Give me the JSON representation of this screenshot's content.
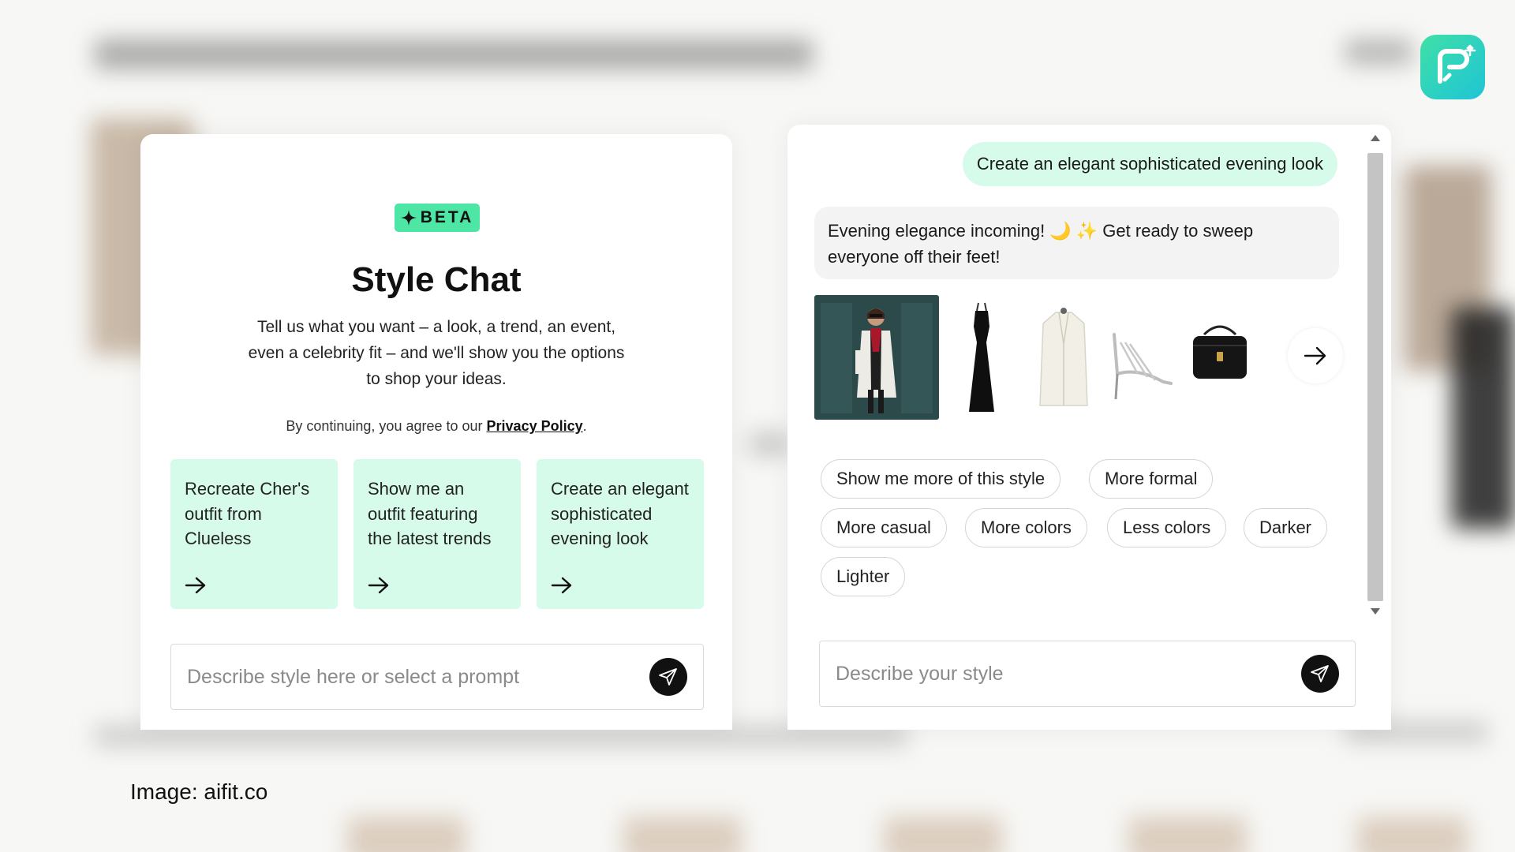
{
  "app_logo": {
    "name": "p-sparkle-logo",
    "colors": [
      "#3fe0a6",
      "#1fc4d6"
    ]
  },
  "left_panel": {
    "badge": "BETA",
    "title": "Style Chat",
    "intro": "Tell us what you want – a look, a trend, an event, even a celebrity fit – and we'll show you the options to shop your ideas.",
    "consent_prefix": "By continuing, you agree to our ",
    "privacy_link": "Privacy Policy",
    "consent_suffix": ".",
    "prompts": [
      {
        "text": "Recreate Cher's outfit from Clueless"
      },
      {
        "text": "Show me an outfit featuring the latest trends"
      },
      {
        "text": "Create an elegant sophisticated evening look"
      }
    ],
    "input_placeholder": "Describe style here or select a prompt"
  },
  "right_panel": {
    "user_message": "Create an elegant sophisticated evening look",
    "bot_message": "Evening elegance incoming! 🌙 ✨ Get ready to sweep everyone off their feet!",
    "products": [
      {
        "name": "woman-in-white-blazer-outfit"
      },
      {
        "name": "black-maxi-dress"
      },
      {
        "name": "white-blazer"
      },
      {
        "name": "silver-strappy-heels"
      },
      {
        "name": "black-shoulder-bag"
      }
    ],
    "chips": [
      "Show me more of this style",
      "More formal",
      "More casual",
      "More colors",
      "Less colors",
      "Darker",
      "Lighter"
    ],
    "input_placeholder": "Describe your style"
  },
  "caption": "Image: aifit.co",
  "colors": {
    "mint_accent": "#4ee6a5",
    "mint_light": "#d7fbea",
    "send_button": "#111111"
  }
}
